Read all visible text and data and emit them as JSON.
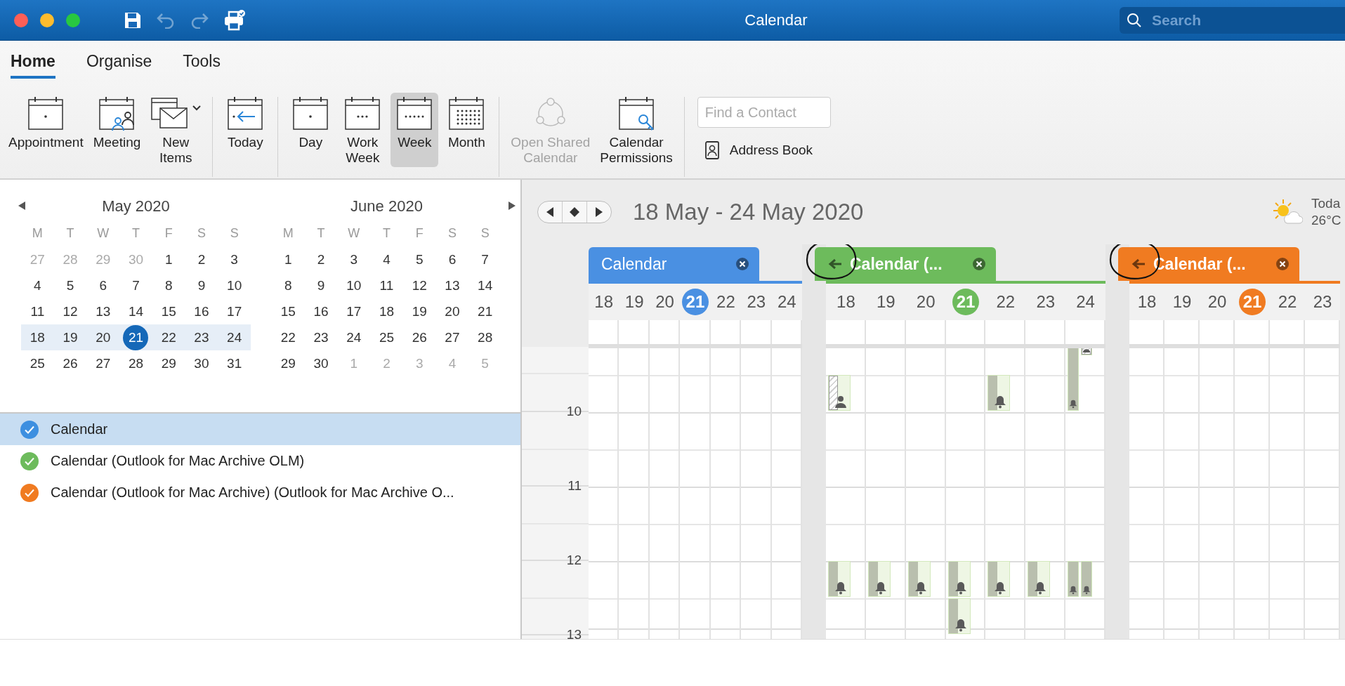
{
  "window": {
    "title": "Calendar",
    "search": {
      "placeholder": "Search"
    }
  },
  "toolbar": [
    {
      "kind": "save",
      "disabled": false
    },
    {
      "kind": "undo",
      "disabled": true
    },
    {
      "kind": "redo",
      "disabled": true
    },
    {
      "kind": "print",
      "disabled": false
    }
  ],
  "ribbon": {
    "tabs": [
      {
        "label": "Home",
        "selected": true
      },
      {
        "label": "Organise",
        "selected": false
      },
      {
        "label": "Tools",
        "selected": false
      }
    ],
    "groups": [
      [
        {
          "kind": "appointment",
          "label": "Appointment",
          "selected": false,
          "disabled": false
        },
        {
          "kind": "meeting",
          "label": "Meeting",
          "selected": false,
          "disabled": false
        },
        {
          "kind": "new-items",
          "label": "New\nItems",
          "selected": false,
          "disabled": false
        }
      ],
      [
        {
          "kind": "today",
          "label": "Today",
          "selected": false,
          "disabled": false
        }
      ],
      [
        {
          "kind": "day",
          "label": "Day",
          "selected": false,
          "disabled": false
        },
        {
          "kind": "work-week",
          "label": "Work\nWeek",
          "selected": false,
          "disabled": false
        },
        {
          "kind": "week",
          "label": "Week",
          "selected": true,
          "disabled": false
        },
        {
          "kind": "month",
          "label": "Month",
          "selected": false,
          "disabled": false
        }
      ],
      [
        {
          "kind": "shared",
          "label": "Open Shared\nCalendar",
          "selected": false,
          "disabled": true
        },
        {
          "kind": "permissions",
          "label": "Calendar\nPermissions",
          "selected": false,
          "disabled": false
        }
      ]
    ],
    "contact_search": {
      "placeholder": "Find a Contact"
    },
    "address_book": {
      "label": "Address Book"
    }
  },
  "mini_calendars": [
    {
      "title": "May 2020",
      "weekdays": [
        "M",
        "T",
        "W",
        "T",
        "F",
        "S",
        "S"
      ],
      "weeks": [
        {
          "selected": false,
          "days": [
            {
              "label": "27",
              "muted": true,
              "today": false
            },
            {
              "label": "28",
              "muted": true,
              "today": false
            },
            {
              "label": "29",
              "muted": true,
              "today": false
            },
            {
              "label": "30",
              "muted": true,
              "today": false
            },
            {
              "label": "1",
              "muted": false,
              "today": false
            },
            {
              "label": "2",
              "muted": false,
              "today": false
            },
            {
              "label": "3",
              "muted": false,
              "today": false
            }
          ]
        },
        {
          "selected": false,
          "days": [
            {
              "label": "4",
              "muted": false,
              "today": false
            },
            {
              "label": "5",
              "muted": false,
              "today": false
            },
            {
              "label": "6",
              "muted": false,
              "today": false
            },
            {
              "label": "7",
              "muted": false,
              "today": false
            },
            {
              "label": "8",
              "muted": false,
              "today": false
            },
            {
              "label": "9",
              "muted": false,
              "today": false
            },
            {
              "label": "10",
              "muted": false,
              "today": false
            }
          ]
        },
        {
          "selected": false,
          "days": [
            {
              "label": "11",
              "muted": false,
              "today": false
            },
            {
              "label": "12",
              "muted": false,
              "today": false
            },
            {
              "label": "13",
              "muted": false,
              "today": false
            },
            {
              "label": "14",
              "muted": false,
              "today": false
            },
            {
              "label": "15",
              "muted": false,
              "today": false
            },
            {
              "label": "16",
              "muted": false,
              "today": false
            },
            {
              "label": "17",
              "muted": false,
              "today": false
            }
          ]
        },
        {
          "selected": true,
          "days": [
            {
              "label": "18",
              "muted": false,
              "today": false
            },
            {
              "label": "19",
              "muted": false,
              "today": false
            },
            {
              "label": "20",
              "muted": false,
              "today": false
            },
            {
              "label": "21",
              "muted": false,
              "today": true
            },
            {
              "label": "22",
              "muted": false,
              "today": false
            },
            {
              "label": "23",
              "muted": false,
              "today": false
            },
            {
              "label": "24",
              "muted": false,
              "today": false
            }
          ]
        },
        {
          "selected": false,
          "days": [
            {
              "label": "25",
              "muted": false,
              "today": false
            },
            {
              "label": "26",
              "muted": false,
              "today": false
            },
            {
              "label": "27",
              "muted": false,
              "today": false
            },
            {
              "label": "28",
              "muted": false,
              "today": false
            },
            {
              "label": "29",
              "muted": false,
              "today": false
            },
            {
              "label": "30",
              "muted": false,
              "today": false
            },
            {
              "label": "31",
              "muted": false,
              "today": false
            }
          ]
        }
      ]
    },
    {
      "title": "June 2020",
      "weekdays": [
        "M",
        "T",
        "W",
        "T",
        "F",
        "S",
        "S"
      ],
      "weeks": [
        {
          "selected": false,
          "days": [
            {
              "label": "1",
              "muted": false,
              "today": false
            },
            {
              "label": "2",
              "muted": false,
              "today": false
            },
            {
              "label": "3",
              "muted": false,
              "today": false
            },
            {
              "label": "4",
              "muted": false,
              "today": false
            },
            {
              "label": "5",
              "muted": false,
              "today": false
            },
            {
              "label": "6",
              "muted": false,
              "today": false
            },
            {
              "label": "7",
              "muted": false,
              "today": false
            }
          ]
        },
        {
          "selected": false,
          "days": [
            {
              "label": "8",
              "muted": false,
              "today": false
            },
            {
              "label": "9",
              "muted": false,
              "today": false
            },
            {
              "label": "10",
              "muted": false,
              "today": false
            },
            {
              "label": "11",
              "muted": false,
              "today": false
            },
            {
              "label": "12",
              "muted": false,
              "today": false
            },
            {
              "label": "13",
              "muted": false,
              "today": false
            },
            {
              "label": "14",
              "muted": false,
              "today": false
            }
          ]
        },
        {
          "selected": false,
          "days": [
            {
              "label": "15",
              "muted": false,
              "today": false
            },
            {
              "label": "16",
              "muted": false,
              "today": false
            },
            {
              "label": "17",
              "muted": false,
              "today": false
            },
            {
              "label": "18",
              "muted": false,
              "today": false
            },
            {
              "label": "19",
              "muted": false,
              "today": false
            },
            {
              "label": "20",
              "muted": false,
              "today": false
            },
            {
              "label": "21",
              "muted": false,
              "today": false
            }
          ]
        },
        {
          "selected": false,
          "days": [
            {
              "label": "22",
              "muted": false,
              "today": false
            },
            {
              "label": "23",
              "muted": false,
              "today": false
            },
            {
              "label": "24",
              "muted": false,
              "today": false
            },
            {
              "label": "25",
              "muted": false,
              "today": false
            },
            {
              "label": "26",
              "muted": false,
              "today": false
            },
            {
              "label": "27",
              "muted": false,
              "today": false
            },
            {
              "label": "28",
              "muted": false,
              "today": false
            }
          ]
        },
        {
          "selected": false,
          "days": [
            {
              "label": "29",
              "muted": false,
              "today": false
            },
            {
              "label": "30",
              "muted": false,
              "today": false
            },
            {
              "label": "1",
              "muted": true,
              "today": false
            },
            {
              "label": "2",
              "muted": true,
              "today": false
            },
            {
              "label": "3",
              "muted": true,
              "today": false
            },
            {
              "label": "4",
              "muted": true,
              "today": false
            },
            {
              "label": "5",
              "muted": true,
              "today": false
            }
          ]
        }
      ]
    }
  ],
  "calendar_list": [
    {
      "name": "Calendar",
      "color": "#3d8fe0",
      "checked": true,
      "selected": true
    },
    {
      "name": "Calendar (Outlook for Mac Archive OLM)",
      "color": "#6dbb5c",
      "checked": true,
      "selected": false
    },
    {
      "name": "Calendar (Outlook for Mac Archive) (Outlook for Mac Archive O...",
      "color": "#f07b21",
      "checked": true,
      "selected": false
    }
  ],
  "date_range": "18 May - 24 May 2020",
  "weather": {
    "label": "Toda",
    "temperature": "26°C"
  },
  "time_labels": [
    "10",
    "11",
    "12",
    "13"
  ],
  "calendars": [
    {
      "name": "Calendar",
      "color": "#4a90e2",
      "back_arrow": false,
      "circled": false,
      "days": [
        {
          "label": "18",
          "today": false
        },
        {
          "label": "19",
          "today": false
        },
        {
          "label": "20",
          "today": false
        },
        {
          "label": "21",
          "today": true
        },
        {
          "label": "22",
          "today": false
        },
        {
          "label": "23",
          "today": false
        },
        {
          "label": "24",
          "today": false
        }
      ]
    },
    {
      "name": "Calendar (...",
      "color": "#6dbb5c",
      "back_arrow": true,
      "circled": true,
      "days": [
        {
          "label": "18",
          "today": false
        },
        {
          "label": "19",
          "today": false
        },
        {
          "label": "20",
          "today": false
        },
        {
          "label": "21",
          "today": true
        },
        {
          "label": "22",
          "today": false
        },
        {
          "label": "23",
          "today": false
        },
        {
          "label": "24",
          "today": false
        }
      ],
      "events": [
        {
          "kind": "person"
        },
        {
          "kind": "bell"
        },
        {
          "kind": "bell"
        },
        {
          "kind": "person"
        },
        {
          "kind": "bell"
        },
        {
          "kind": "bell"
        },
        {
          "kind": "bell"
        },
        {
          "kind": "bell"
        },
        {
          "kind": "bell"
        },
        {
          "kind": "bell"
        },
        {
          "kind": "bell"
        },
        {
          "kind": "bell"
        },
        {
          "kind": "bell"
        }
      ]
    },
    {
      "name": "Calendar (...",
      "color": "#f07b21",
      "back_arrow": true,
      "circled": true,
      "days": [
        {
          "label": "18",
          "today": false
        },
        {
          "label": "19",
          "today": false
        },
        {
          "label": "20",
          "today": false
        },
        {
          "label": "21",
          "today": true
        },
        {
          "label": "22",
          "today": false
        },
        {
          "label": "23",
          "today": false
        }
      ]
    }
  ]
}
